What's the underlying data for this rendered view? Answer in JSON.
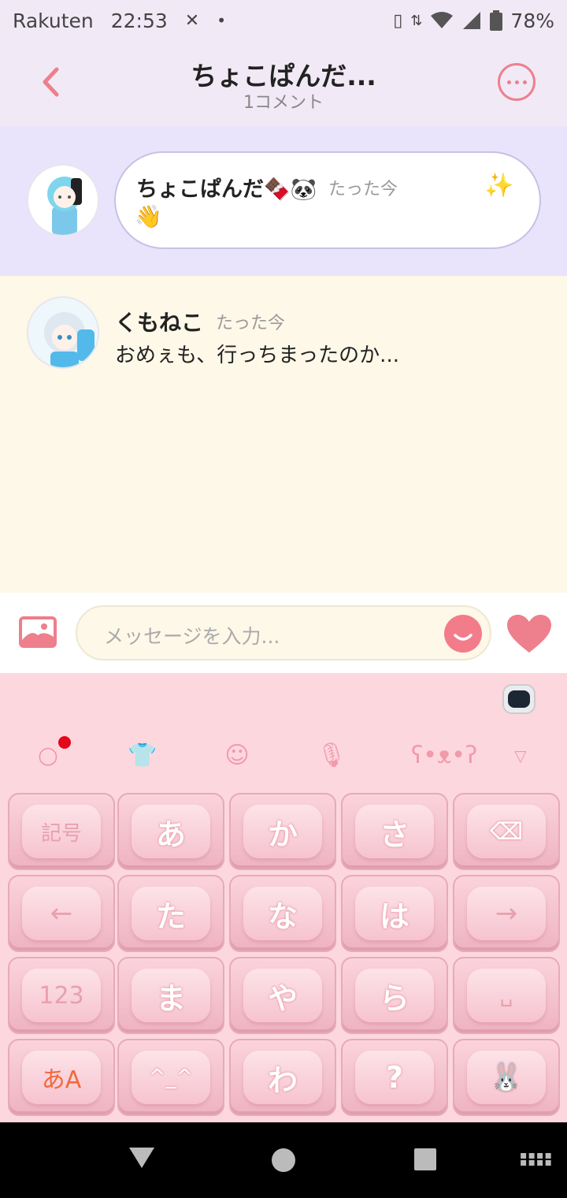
{
  "status_bar": {
    "carrier": "Rakuten",
    "time": "22:53",
    "battery": "78%"
  },
  "header": {
    "title": "ちょこぱんだ...",
    "subtitle": "1コメント"
  },
  "post": {
    "author": "ちょこぱんだ🍫🐼",
    "time": "たった今",
    "body": "👋",
    "decoration": "✨"
  },
  "comment": {
    "author": "くもねこ",
    "time": "たった今",
    "text": "おめぇも、行っちまったのか..."
  },
  "input": {
    "placeholder": "メッセージを入力..."
  },
  "keyboard": {
    "rows": [
      [
        "記号",
        "あ",
        "か",
        "さ",
        "⌫"
      ],
      [
        "←",
        "た",
        "な",
        "は",
        "→"
      ],
      [
        "123",
        "ま",
        "や",
        "ら",
        "␣"
      ],
      [
        "あA",
        "^_^",
        "わ",
        "?",
        "🐰"
      ]
    ]
  },
  "colors": {
    "accent": "#ee7f8c",
    "header_bg": "#f1eaf6",
    "post_bg": "#e9e4fb",
    "comment_bg": "#fdf8e8",
    "keyboard_bg": "#fdd7de",
    "notification_dot": "#e5071a"
  }
}
